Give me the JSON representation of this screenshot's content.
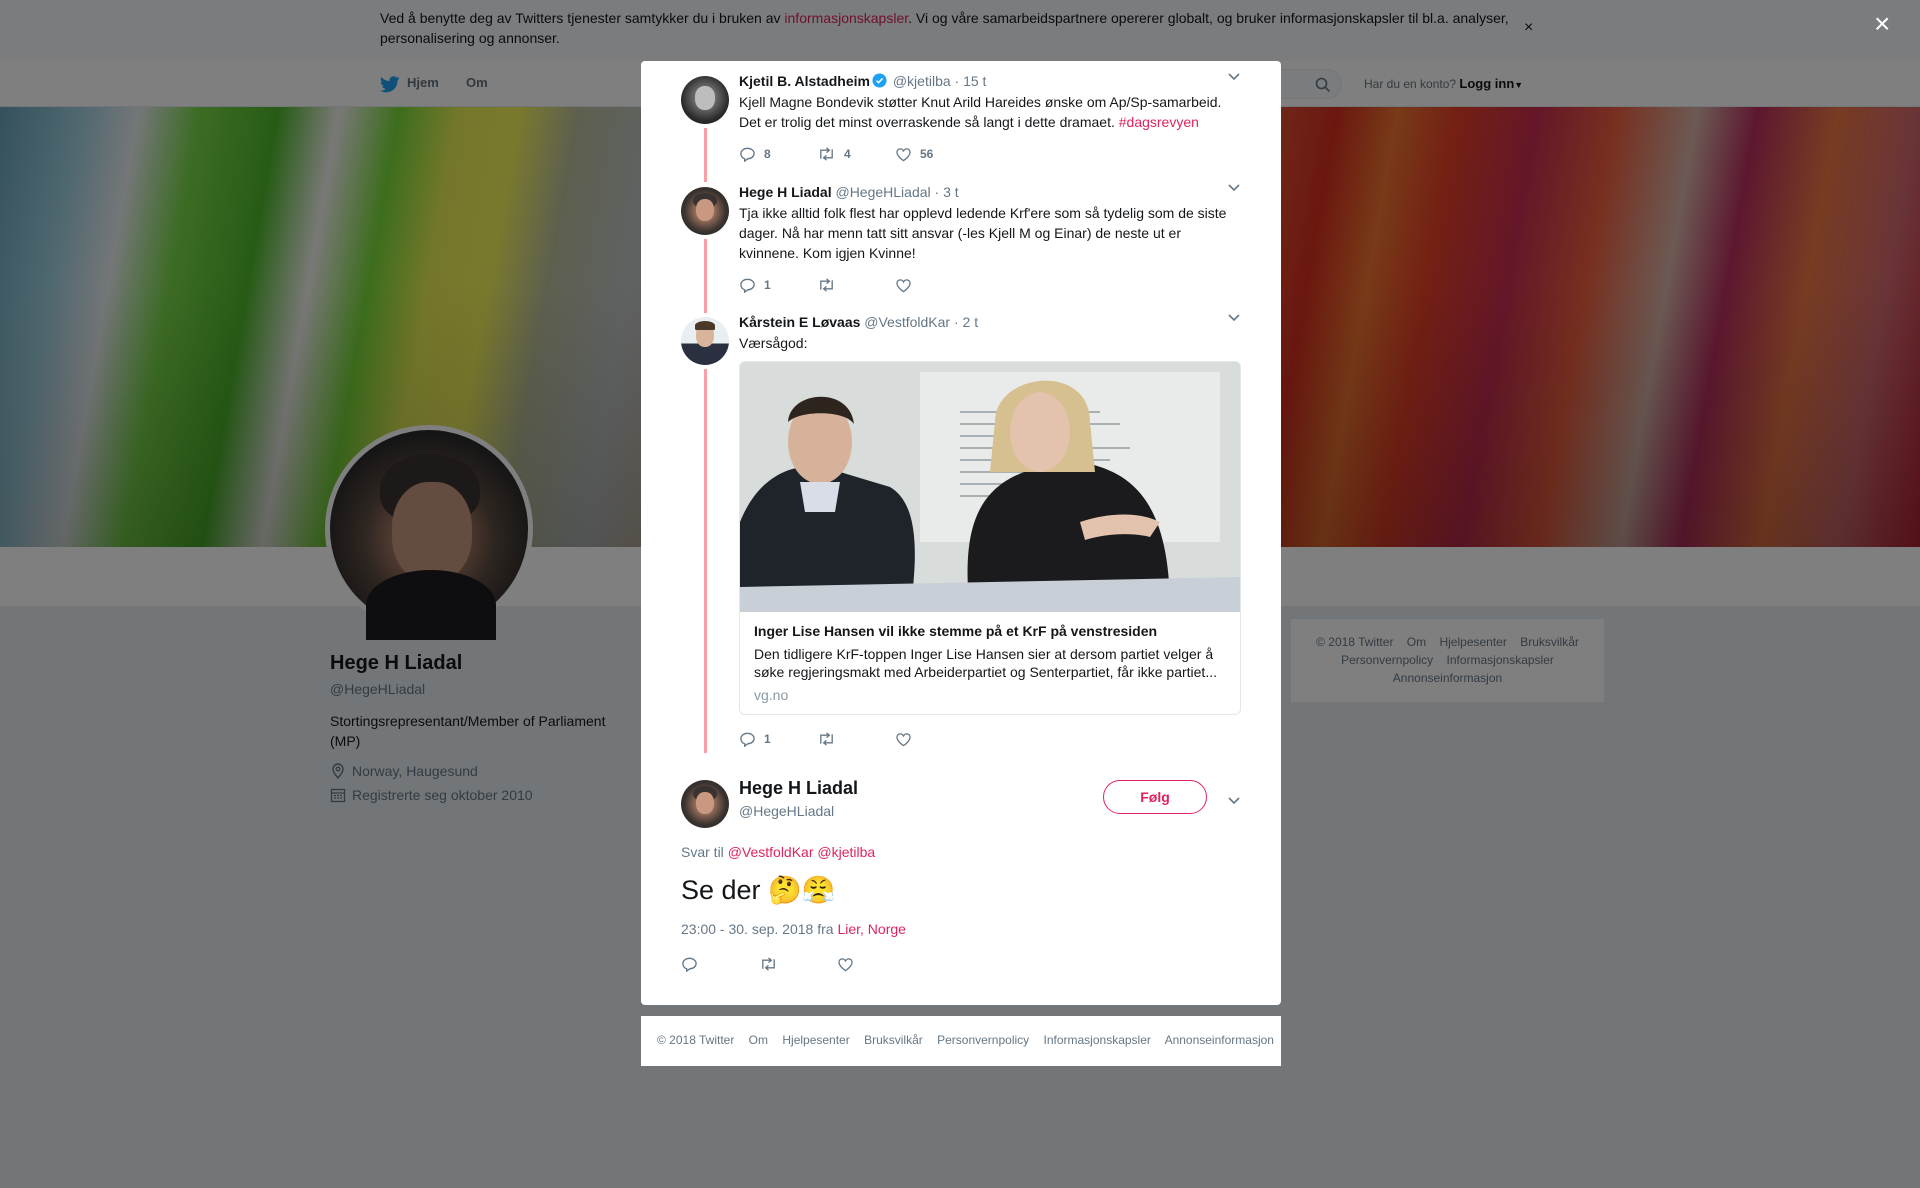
{
  "cookie_banner": {
    "text_before": "Ved å benytte deg av Twitters tjenester samtykker du i bruken av ",
    "link": "informasjonskapsler",
    "text_after": ". Vi og våre samarbeidspartnere opererer globalt, og bruker informasjonskapsler til bl.a. analyser, personalisering og annonser.",
    "close": "×"
  },
  "top_nav": {
    "home": "Hjem",
    "about": "Om",
    "account_prompt": "Har du en konto?",
    "login": "Logg inn"
  },
  "profile": {
    "name": "Hege H Liadal",
    "handle": "@HegeHLiadal",
    "bio": "Stortingsrepresentant/Member of Parliament (MP)",
    "location": "Norway, Haugesund",
    "joined": "Registrerte seg oktober 2010"
  },
  "side_footer": [
    "© 2018 Twitter",
    "Om",
    "Hjelpesenter",
    "Bruksvilkår",
    "Personvernpolicy",
    "Informasjonskapsler",
    "Annonseinformasjon"
  ],
  "modal_close": "×",
  "tweets": [
    {
      "name": "Kjetil B. Alstadheim",
      "handle": "@kjetilba",
      "time": "· 15 t",
      "text": "Kjell Magne Bondevik støtter Knut Arild Hareides ønske om Ap/Sp-samarbeid. Det er trolig det minst overraskende så langt i dette dramaet. ",
      "hashtag": "#dagsrevyen",
      "replies": "8",
      "retweets": "4",
      "likes": "56"
    },
    {
      "name": "Hege H Liadal",
      "handle": "@HegeHLiadal",
      "time": "· 3 t",
      "text": "Tja ikke alltid folk flest har opplevd ledende Krf'ere som så tydelig som de siste dager. Nå har menn tatt sitt ansvar (-les Kjell M og Einar) de neste ut er kvinnene. Kom igjen Kvinne!",
      "replies": "1",
      "retweets": "",
      "likes": ""
    },
    {
      "name": "Kårstein E Løvaas",
      "handle": "@VestfoldKar",
      "time": "· 2 t",
      "text": "Værsågod:",
      "card": {
        "title": "Inger Lise Hansen vil ikke stemme på et KrF på venstresiden",
        "description": "Den tidligere KrF-toppen Inger Lise Hansen sier at dersom partiet velger å søke regjeringsmakt med Arbeiderpartiet og Senterpartiet, får ikke partiet...",
        "domain": "vg.no"
      },
      "replies": "1",
      "retweets": "",
      "likes": ""
    }
  ],
  "main_tweet": {
    "name": "Hege H Liadal",
    "handle": "@HegeHLiadal",
    "follow": "Følg",
    "reply_to_label": "Svar til ",
    "reply_to_1": "@VestfoldKar",
    "reply_to_2": "@kjetilba",
    "text": "Se der 🤔😤",
    "timestamp": "23:00 - 30. sep. 2018 fra ",
    "place": "Lier, Norge"
  },
  "modal_footer": [
    "© 2018 Twitter",
    "Om",
    "Hjelpesenter",
    "Bruksvilkår",
    "Personvernpolicy",
    "Informasjonskapsler",
    "Annonseinformasjon"
  ],
  "icons": {
    "reply": "reply-icon",
    "retweet": "retweet-icon",
    "like": "heart-icon",
    "caret": "chevron-down-icon",
    "verified": "verified-badge-icon",
    "location": "location-pin-icon",
    "calendar": "calendar-icon"
  },
  "colors": {
    "accent": "#e0245e",
    "thread_line": "#fb9fa6",
    "verified": "#1da1f2",
    "secondary_text": "#657786"
  }
}
